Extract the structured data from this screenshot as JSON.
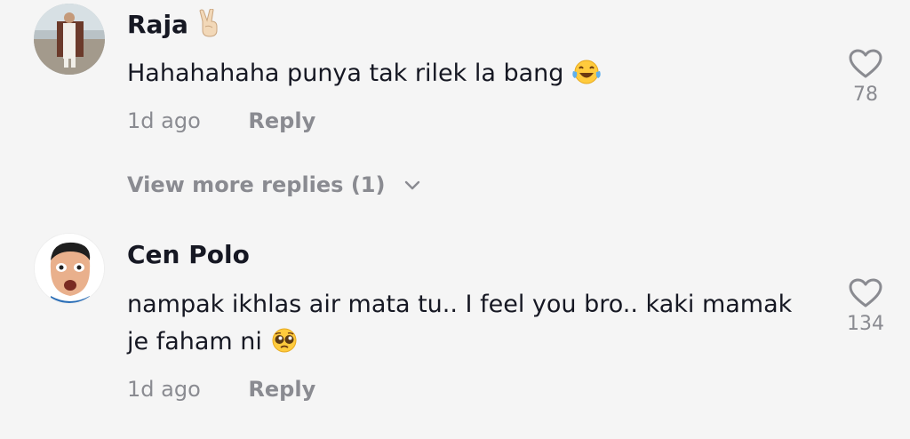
{
  "comments": [
    {
      "username": "Raja",
      "username_emoji": "victory-hand-emoji",
      "text": "Hahahahaha punya tak rilek la bang",
      "text_emoji": "tears-of-joy-emoji",
      "time": "1d ago",
      "reply_label": "Reply",
      "likes": "78"
    },
    {
      "username": "Cen Polo",
      "text_line1": "nampak ikhlas air mata tu.. I feel you bro.. kaki mamak",
      "text_line2": "je faham ni",
      "text_emoji": "pleading-face-emoji",
      "time": "1d ago",
      "reply_label": "Reply",
      "likes": "134"
    }
  ],
  "view_more": {
    "label": "View more replies (1)",
    "icon": "chevron-down-icon"
  },
  "colors": {
    "background": "#f5f5f5",
    "primary_text": "#161823",
    "secondary_text": "#8a8b91"
  }
}
